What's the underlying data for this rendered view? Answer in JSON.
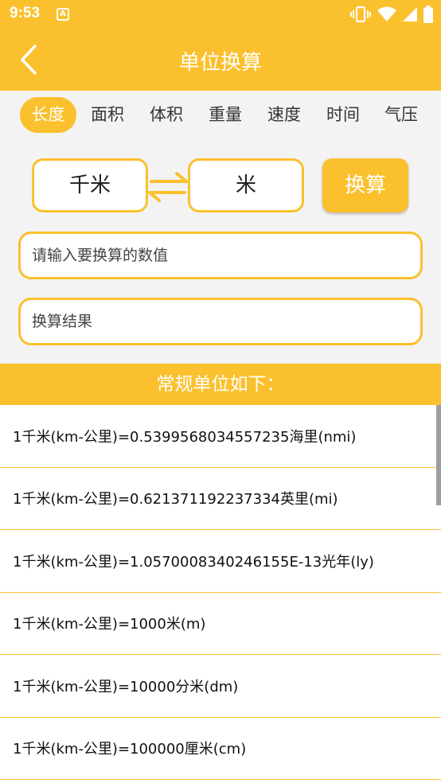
{
  "status_bar": {
    "time": "9:53",
    "notification_glyph": "A",
    "icons": [
      "vibrate-icon",
      "wifi-icon",
      "cell-signal-icon",
      "battery-icon"
    ]
  },
  "header": {
    "title": "单位换算"
  },
  "tabs": [
    {
      "label": "长度",
      "active": true
    },
    {
      "label": "面积",
      "active": false
    },
    {
      "label": "体积",
      "active": false
    },
    {
      "label": "重量",
      "active": false
    },
    {
      "label": "速度",
      "active": false
    },
    {
      "label": "时间",
      "active": false
    },
    {
      "label": "气压",
      "active": false
    }
  ],
  "converter": {
    "from_unit": "千米",
    "to_unit": "米",
    "convert_label": "换算",
    "input_placeholder": "请输入要换算的数值",
    "input_value": "",
    "result_placeholder": "换算结果",
    "result_value": ""
  },
  "section": {
    "title": "常规单位如下："
  },
  "results": [
    "1千米(km-公里)=0.5399568034557235海里(nmi)",
    "1千米(km-公里)=0.621371192237334英里(mi)",
    "1千米(km-公里)=1.0570008340246155E-13光年(ly)",
    "1千米(km-公里)=1000米(m)",
    "1千米(km-公里)=10000分米(dm)",
    "1千米(km-公里)=100000厘米(cm)"
  ],
  "colors": {
    "accent": "#fbc02d",
    "panel_bg": "#f3f3f3",
    "text": "#222222",
    "white": "#ffffff"
  }
}
